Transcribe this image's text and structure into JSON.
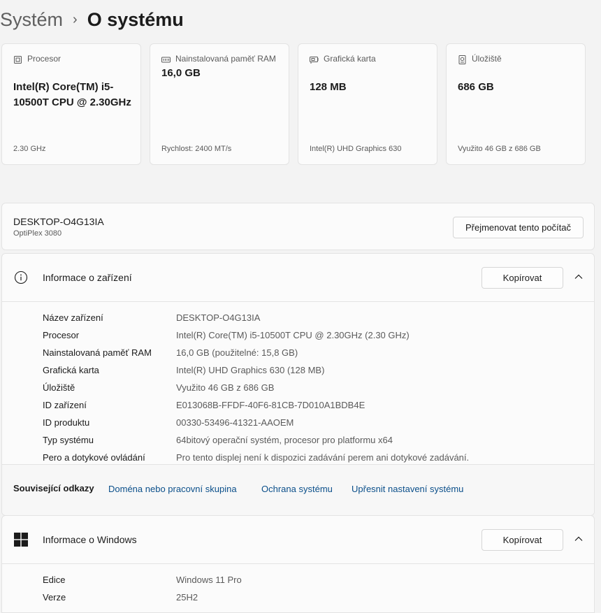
{
  "breadcrumb": {
    "parent": "Systém",
    "separator": "›",
    "current": "O systému"
  },
  "spec_cards": [
    {
      "icon": "processor-icon",
      "label": "Procesor",
      "value": "Intel(R) Core(TM) i5-10500T CPU @ 2.30GHz",
      "sub": "2.30 GHz"
    },
    {
      "icon": "memory-icon",
      "label": "Nainstalovaná paměť RAM",
      "value": "16,0 GB",
      "sub": "Rychlost: 2400 MT/s"
    },
    {
      "icon": "graphics-card-icon",
      "label": "Grafická karta",
      "value": "128 MB",
      "sub": "Intel(R) UHD Graphics 630"
    },
    {
      "icon": "storage-icon",
      "label": "Úložiště",
      "value": "686 GB",
      "sub": "Využito 46 GB z 686 GB"
    }
  ],
  "device": {
    "name": "DESKTOP-O4G13IA",
    "model": "OptiPlex 3080",
    "rename_label": "Přejmenovat tento počítač"
  },
  "device_info": {
    "title": "Informace o zařízení",
    "copy_label": "Kopírovat",
    "rows": [
      {
        "label": "Název zařízení",
        "value": "DESKTOP-O4G13IA"
      },
      {
        "label": "Procesor",
        "value": "Intel(R) Core(TM) i5-10500T CPU @ 2.30GHz (2.30 GHz)"
      },
      {
        "label": "Nainstalovaná paměť RAM",
        "value": "16,0 GB (použitelné: 15,8 GB)"
      },
      {
        "label": "Grafická karta",
        "value": "Intel(R) UHD Graphics 630 (128 MB)"
      },
      {
        "label": "Úložiště",
        "value": "Využito 46 GB z 686 GB"
      },
      {
        "label": "ID zařízení",
        "value": "E013068B-FFDF-40F6-81CB-7D010A1BDB4E"
      },
      {
        "label": "ID produktu",
        "value": "00330-53496-41321-AAOEM"
      },
      {
        "label": "Typ systému",
        "value": "64bitový operační systém, procesor pro platformu x64"
      },
      {
        "label": "Pero a dotykové ovládání",
        "value": "Pro tento displej není k dispozici zadávání perem ani dotykové zadávání."
      }
    ]
  },
  "related_links": {
    "title": "Související odkazy",
    "links": [
      "Doména nebo pracovní skupina",
      "Ochrana systému",
      "Upřesnit nastavení systému"
    ]
  },
  "windows_info": {
    "title": "Informace o Windows",
    "copy_label": "Kopírovat",
    "rows": [
      {
        "label": "Edice",
        "value": "Windows 11 Pro"
      },
      {
        "label": "Verze",
        "value": "25H2"
      }
    ]
  },
  "colors": {
    "accent_link": "#0b4f8a",
    "windows_logo": "#1b1b1b"
  }
}
